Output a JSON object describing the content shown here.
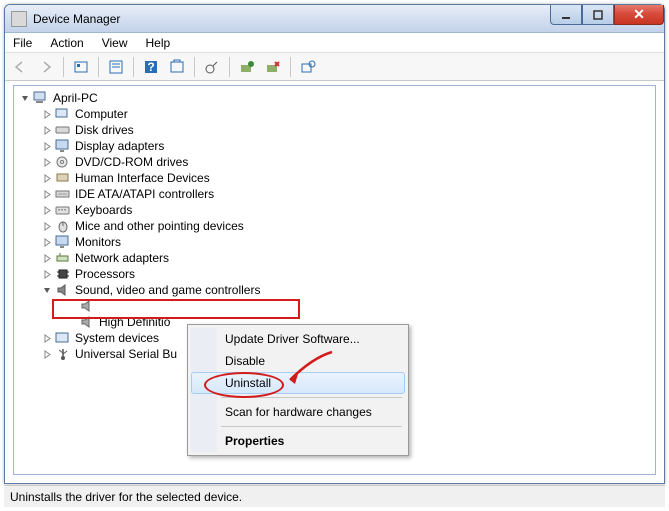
{
  "window": {
    "title": "Device Manager"
  },
  "menu": {
    "file": "File",
    "action": "Action",
    "view": "View",
    "help": "Help"
  },
  "tree": {
    "root": "April-PC",
    "items": [
      "Computer",
      "Disk drives",
      "Display adapters",
      "DVD/CD-ROM drives",
      "Human Interface Devices",
      "IDE ATA/ATAPI controllers",
      "Keyboards",
      "Mice and other pointing devices",
      "Monitors",
      "Network adapters",
      "Processors",
      "Sound, video and game controllers",
      "High Definitio",
      "System devices",
      "Universal Serial Bu"
    ]
  },
  "context_menu": {
    "update": "Update Driver Software...",
    "disable": "Disable",
    "uninstall": "Uninstall",
    "scan": "Scan for hardware changes",
    "properties": "Properties"
  },
  "status": {
    "text": "Uninstalls the driver for the selected device."
  },
  "colors": {
    "annotation": "#d21b1b"
  }
}
